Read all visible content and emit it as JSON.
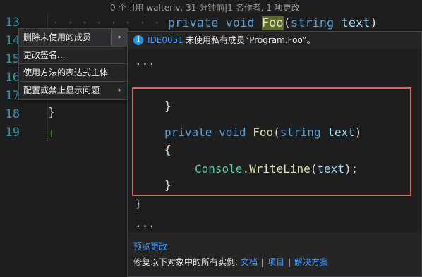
{
  "codelens": "0 个引用|walterlv, 31 分钟前|1 名作者, 1 项更改",
  "line_numbers": [
    "13",
    "14",
    "15",
    "16",
    "17",
    "18",
    "19"
  ],
  "editor": {
    "kw_private": "private",
    "kw_void": "void",
    "method_name": "Foo",
    "paren_open": "(",
    "kw_string": "string",
    "param": "text",
    "paren_close": ")",
    "line17_tail": ");",
    "line18": "}"
  },
  "menu": {
    "items": [
      {
        "label": "删除未使用的成员"
      },
      {
        "label": "更改签名..."
      },
      {
        "label": "使用方法的表达式主体"
      },
      {
        "label": "配置或禁止显示问题"
      }
    ],
    "arrow": "▸"
  },
  "diagnostic": {
    "code": "IDE0051",
    "message": "未使用私有成员“Program.Foo”。",
    "icon": "info-icon",
    "icon_glyph": "i"
  },
  "preview": {
    "ellipsis": "...",
    "brace_close_inner": "}",
    "kw_private": "private",
    "kw_void": "void",
    "method_name": "Foo",
    "kw_string": "string",
    "param": "text",
    "brace_open": "{",
    "console": "Console",
    "dot": ".",
    "writeline": "WriteLine",
    "arg": "text",
    "brace_close_method": "}",
    "brace_close_class": "}"
  },
  "footer": {
    "preview_changes": "预览更改",
    "fix_all_prefix": "修复以下对象中的所有实例:",
    "link_document": "文档",
    "link_project": "项目",
    "link_solution": "解决方案",
    "separator": "|"
  },
  "colors": {
    "keyword": "#569cd6",
    "method": "#dcdcaa",
    "type": "#4ec9b0",
    "identifier": "#9cdcfe",
    "line_number": "#2b91af",
    "link": "#3794ff",
    "diff_border": "#d9645e"
  }
}
